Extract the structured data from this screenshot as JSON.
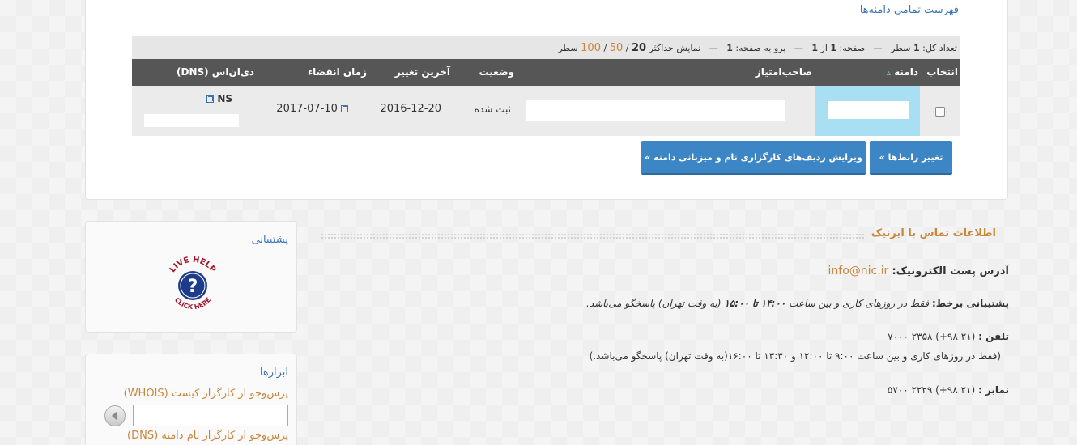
{
  "domains": {
    "title": "فهرست تمامی دامنه‌ها",
    "pager": {
      "total_label": "تعداد کل:",
      "total": "1",
      "rows_word": "سطر",
      "page_label": "صفحه:",
      "page": "1",
      "of_label": "از",
      "pages": "1",
      "goto_label": "برو به صفحه:",
      "goto": "1",
      "show_max_label": "نمایش حداکثر",
      "size_current": "20",
      "size_50": "50",
      "size_100": "100",
      "sep": "—",
      "slash": "/"
    },
    "columns": {
      "select": "انتخاب",
      "domain": "دامنه",
      "sort_icon": "▵",
      "owner": "صاحب‌امتیاز",
      "status": "وضعیت",
      "last_change": "آخرین تغییر",
      "expire": "زمان انقضاء",
      "dns": "دی‌ان‌اس (DNS)"
    },
    "rows": [
      {
        "status": "ثبت شده",
        "last_change": "2016-12-20",
        "expire": "2017-07-10",
        "dns_label": "NS"
      }
    ],
    "buttons": {
      "change_contacts": "تغییر رابط‌ها »",
      "edit_ns": "ویرایش ردیف‌های کارگزاری نام و میزبانی دامنه »"
    }
  },
  "support": {
    "title": "پشتیبانی",
    "live_help_top": "LIVE HELP",
    "live_help_bottom": "CLICK HERE"
  },
  "tools": {
    "title": "ابزارها",
    "whois_link": "پرس‌وجو از کارگزار کیست (WHOIS)",
    "dns_link": "پرس‌وجو از کارگزار نام دامنه (DNS)"
  },
  "contact": {
    "title": "اطلاعات تماس با ایرنیک",
    "email_label": "آدرس پست الکترونیک:",
    "email": "info@nic.ir",
    "online_label": "پشتیبانی برخط:",
    "online_text_1": "فقط در روزهای کاری و بین ساعت",
    "online_from": "۱۴:۰۰",
    "online_to_word": "تا",
    "online_to": "۱۵:۰۰",
    "online_text_2": "(به وقت تهران) پاسخگو می‌باشد.",
    "phone_label": "تلفن :",
    "phone": "(۲۱ ۹۸+) ۲۳۵۸ ۷۰۰۰",
    "phone_note": "(فقط در روزهای کاری و بین ساعت ۹:۰۰ تا ۱۲:۰۰ و ۱۳:۳۰ تا ۱۶:۰۰(به وقت تهران) پاسخگو می‌باشد.)",
    "fax_label": "نمابر :",
    "fax": "(۲۱ ۹۸+) ۲۲۲۹ ۵۷۰۰"
  }
}
